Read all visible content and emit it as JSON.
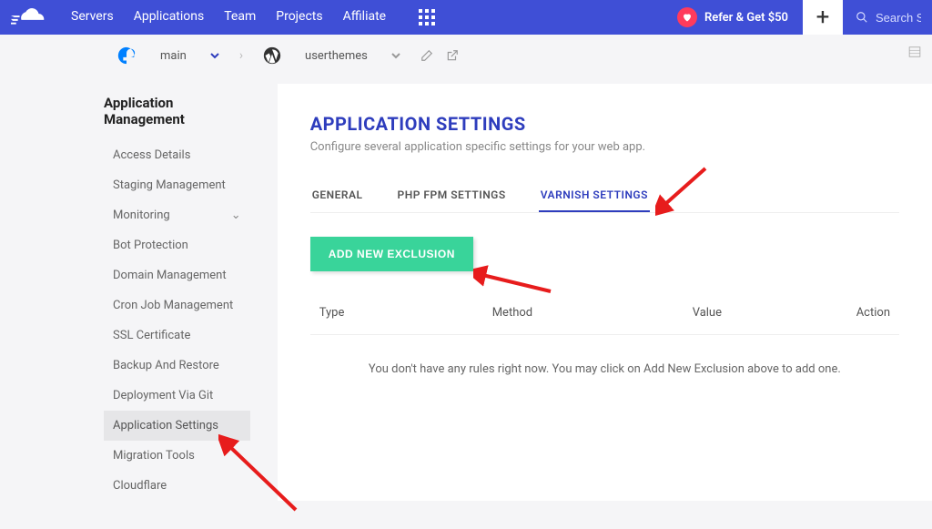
{
  "topnav": [
    "Servers",
    "Applications",
    "Team",
    "Projects",
    "Affiliate"
  ],
  "refer": "Refer & Get $50",
  "search_placeholder": "Search S",
  "breadcrumb": {
    "server": "main",
    "app": "userthemes"
  },
  "sidebar": {
    "title": "Application Management",
    "items": [
      {
        "label": "Access Details"
      },
      {
        "label": "Staging Management"
      },
      {
        "label": "Monitoring",
        "expandable": true
      },
      {
        "label": "Bot Protection"
      },
      {
        "label": "Domain Management"
      },
      {
        "label": "Cron Job Management"
      },
      {
        "label": "SSL Certificate"
      },
      {
        "label": "Backup And Restore"
      },
      {
        "label": "Deployment Via Git"
      },
      {
        "label": "Application Settings",
        "active": true
      },
      {
        "label": "Migration Tools"
      },
      {
        "label": "Cloudflare"
      }
    ]
  },
  "main": {
    "title": "APPLICATION SETTINGS",
    "subtitle": "Configure several application specific settings for your web app.",
    "tabs": [
      {
        "label": "GENERAL"
      },
      {
        "label": "PHP FPM SETTINGS"
      },
      {
        "label": "VARNISH SETTINGS",
        "active": true
      }
    ],
    "add_button": "ADD NEW EXCLUSION",
    "table": {
      "headers": {
        "type": "Type",
        "method": "Method",
        "value": "Value",
        "action": "Action"
      },
      "empty": "You don't have any rules right now. You may click on Add New Exclusion above to add one."
    }
  }
}
